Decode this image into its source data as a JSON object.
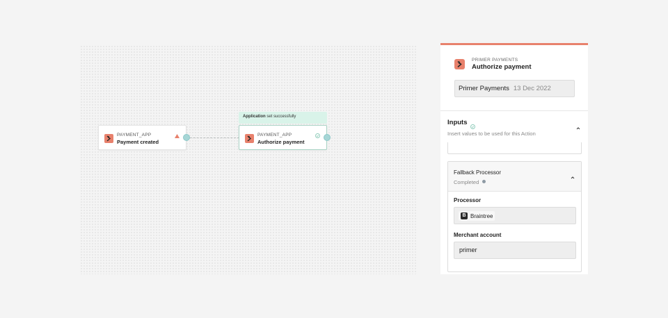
{
  "canvas": {
    "toast": {
      "bold": "Application",
      "rest": " set successfully"
    },
    "nodes": [
      {
        "app": "PAYMENT_APP",
        "title": "Payment created",
        "status_icon": "warning-triangle-icon"
      },
      {
        "app": "PAYMENT_APP",
        "title": "Authorize payment",
        "status_icon": "check-circle-icon"
      }
    ]
  },
  "panel": {
    "app": "PRIMER PAYMENTS",
    "title": "Authorize payment",
    "connection": {
      "name": "Primer Payments",
      "date": "13 Dec 2022"
    },
    "inputs": {
      "title": "Inputs",
      "description": "Insert values to be used for this Action",
      "fallback": {
        "title": "Fallback Processor",
        "status": "Completed",
        "processor_label": "Processor",
        "processor_value": "Braintree",
        "processor_logo": "B",
        "merchant_label": "Merchant account",
        "merchant_value": "primer"
      }
    }
  },
  "colors": {
    "brand": "#e8816c",
    "success_toast": "#d9f3e9",
    "port": "#a6d6d6",
    "selected_border": "#a8d2c4"
  }
}
